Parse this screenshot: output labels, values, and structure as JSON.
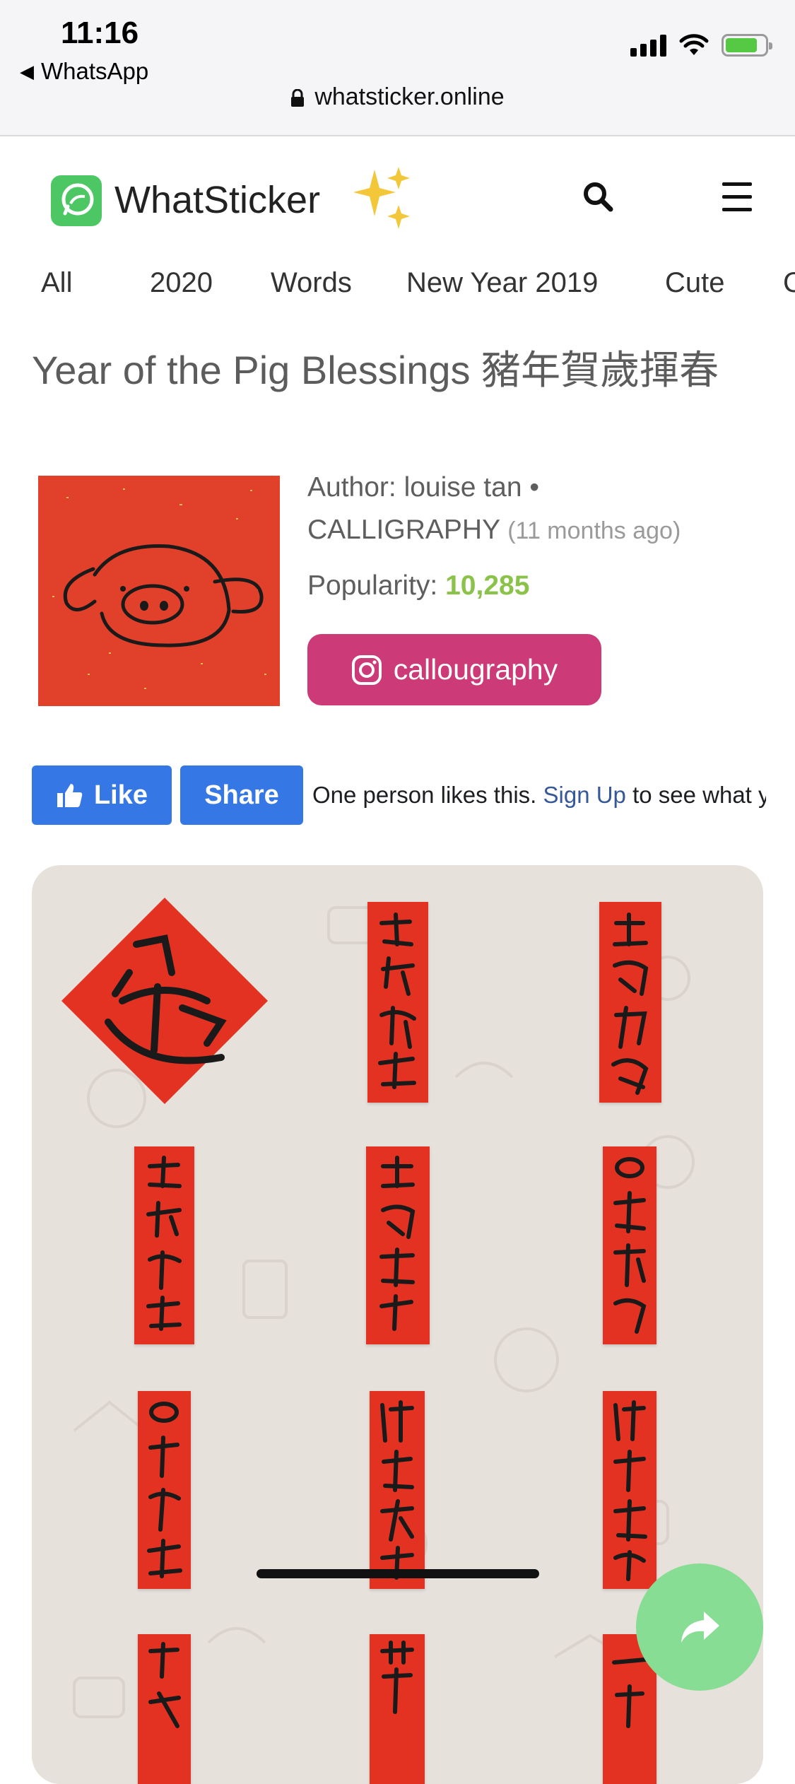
{
  "status_bar": {
    "time": "11:16",
    "back_app": "WhatsApp"
  },
  "browser": {
    "url": "whatsticker.online"
  },
  "site": {
    "brand": "WhatSticker"
  },
  "nav": {
    "items": [
      "All",
      "2020",
      "Words",
      "New Year 2019",
      "Cute",
      "C"
    ]
  },
  "pack": {
    "title": "Year of the Pig Blessings 豬年賀歲揮春",
    "author_line": "Author: louise tan •",
    "category": "CALLIGRAPHY",
    "age": "(11 months ago)",
    "popularity_label": "Popularity:",
    "popularity_value": "10,285",
    "instagram_handle": "callougraphy"
  },
  "facebook": {
    "like_label": "Like",
    "share_label": "Share",
    "text_before": "One person likes this.",
    "link": "Sign Up",
    "text_after": " to see what y"
  },
  "colors": {
    "accent_green": "#8bc34a",
    "instagram": "#cc3a77",
    "facebook": "#3578e5",
    "sticker_red": "#e33222"
  },
  "icons": [
    "lock-icon",
    "search-icon",
    "menu-icon",
    "sparkles-icon",
    "instagram-icon",
    "thumbs-up-icon",
    "share-arrow-icon"
  ]
}
